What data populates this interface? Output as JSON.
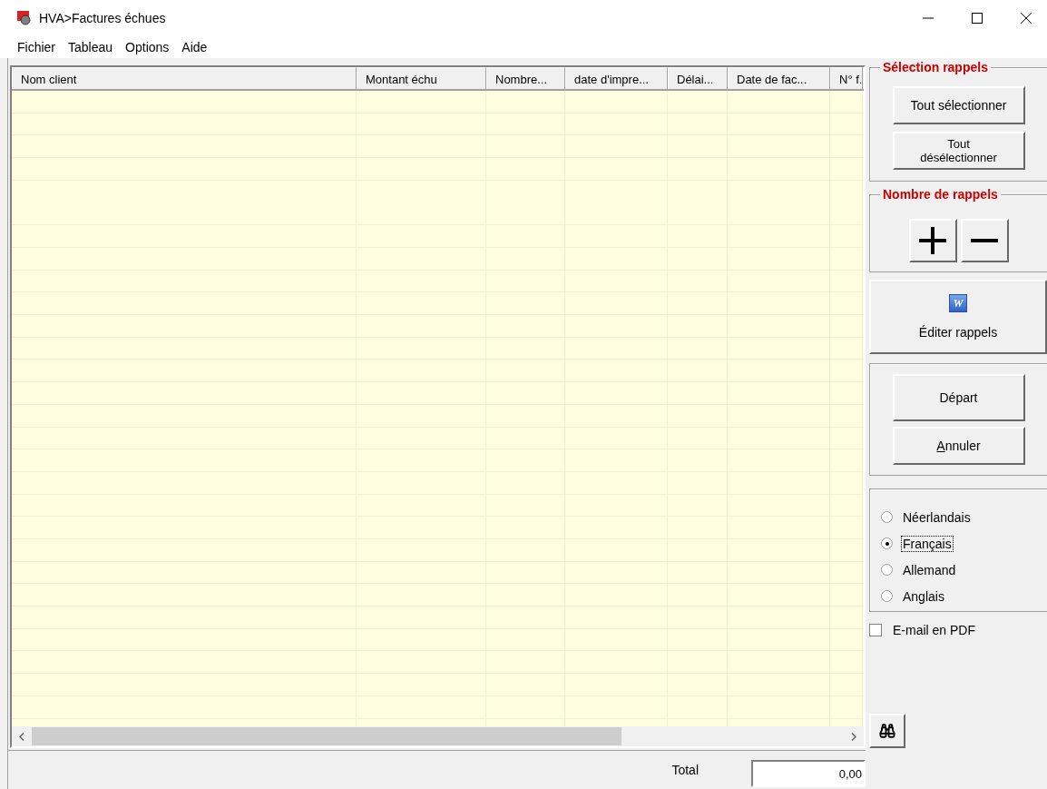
{
  "window": {
    "title": "HVA>Factures échues"
  },
  "menu": [
    "Fichier",
    "Tableau",
    "Options",
    "Aide"
  ],
  "table": {
    "columns": [
      {
        "label": "Nom client"
      },
      {
        "label": "Montant échu"
      },
      {
        "label": "Nombre..."
      },
      {
        "label": "date d'impre..."
      },
      {
        "label": "Délai..."
      },
      {
        "label": "Date de fac..."
      },
      {
        "label": "N° f."
      }
    ]
  },
  "footer": {
    "total_label": "Total",
    "total_value": "0,00"
  },
  "side": {
    "selection": {
      "title": "Sélection rappels",
      "buttons": [
        "Tout sélectionner",
        "Tout désélectionner"
      ]
    },
    "count": {
      "title": "Nombre de rappels"
    },
    "edit": {
      "icon_letter": "W",
      "label": "Éditer rappels"
    },
    "actions": [
      {
        "label": "Départ",
        "mnemonic": false
      },
      {
        "label": "Annuler",
        "mnemonic": true
      }
    ],
    "languages": [
      {
        "label": "Néerlandais",
        "selected": false
      },
      {
        "label": "Français",
        "selected": true
      },
      {
        "label": "Allemand",
        "selected": false
      },
      {
        "label": "Anglais",
        "selected": false
      }
    ],
    "email_pdf": {
      "label": "E-mail en PDF",
      "checked": false
    }
  }
}
